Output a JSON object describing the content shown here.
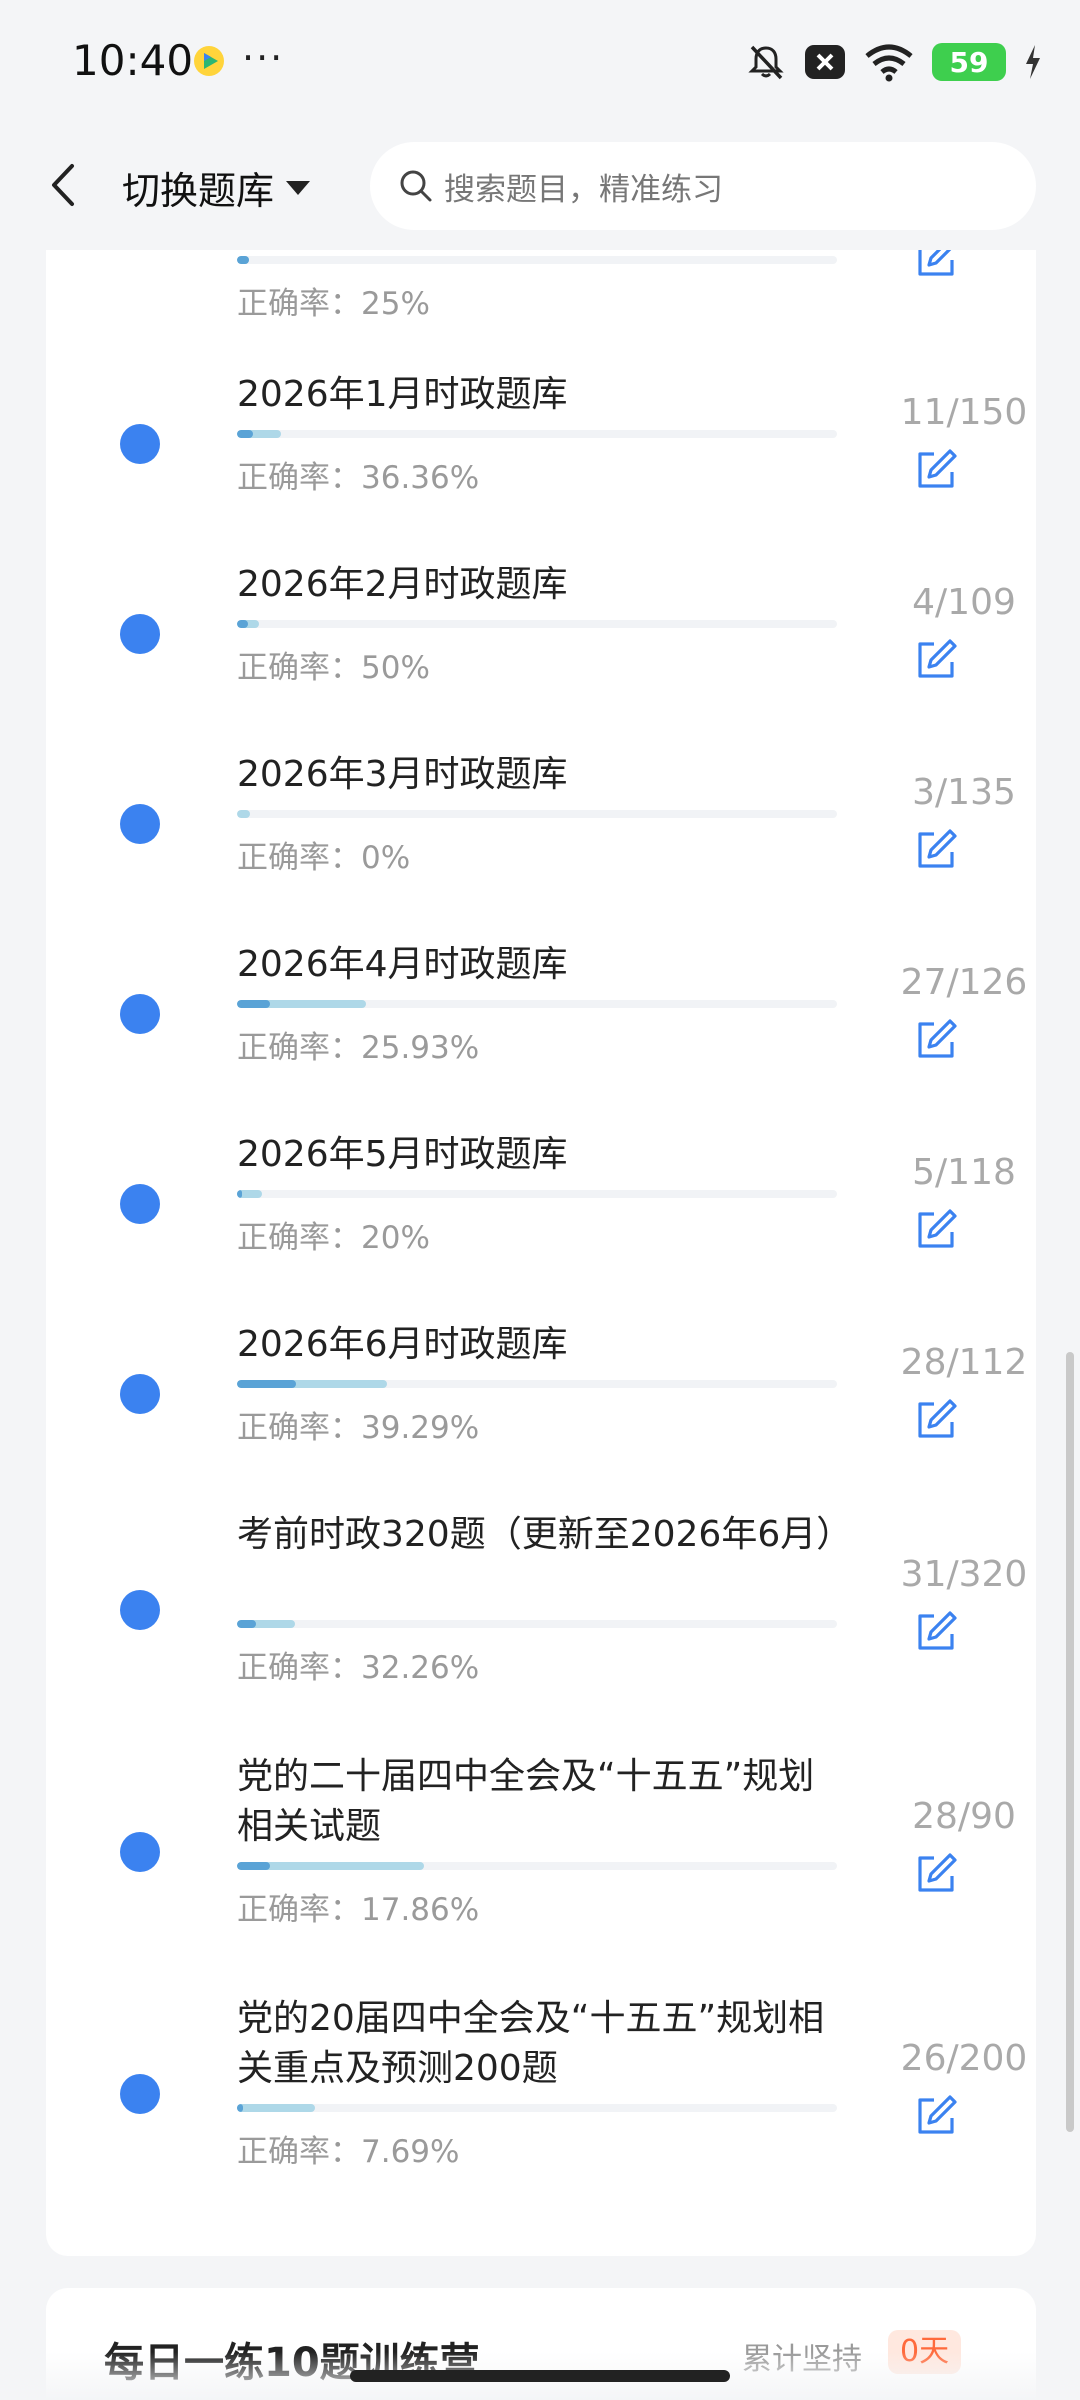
{
  "status": {
    "time": "10:40",
    "battery": "59"
  },
  "nav": {
    "switch_label": "切换题库",
    "search_placeholder": "搜索题目，精准练习"
  },
  "partial_item": {
    "accuracy": "正确率：25%",
    "progress": {
      "done": 0.02,
      "correct": 0.02
    }
  },
  "items": [
    {
      "title": "2026年1月时政题库",
      "count": "11/150",
      "accuracy": "正确率：36.36%",
      "progress": {
        "done": 0.0733,
        "correct": 0.0267
      }
    },
    {
      "title": "2026年2月时政题库",
      "count": "4/109",
      "accuracy": "正确率：50%",
      "progress": {
        "done": 0.0367,
        "correct": 0.0183
      }
    },
    {
      "title": "2026年3月时政题库",
      "count": "3/135",
      "accuracy": "正确率：0%",
      "progress": {
        "done": 0.0222,
        "correct": 0
      }
    },
    {
      "title": "2026年4月时政题库",
      "count": "27/126",
      "accuracy": "正确率：25.93%",
      "progress": {
        "done": 0.2143,
        "correct": 0.0556
      }
    },
    {
      "title": "2026年5月时政题库",
      "count": "5/118",
      "accuracy": "正确率：20%",
      "progress": {
        "done": 0.0424,
        "correct": 0.0085
      }
    },
    {
      "title": "2026年6月时政题库",
      "count": "28/112",
      "accuracy": "正确率：39.29%",
      "progress": {
        "done": 0.25,
        "correct": 0.0982
      }
    },
    {
      "title": "考前时政320题（更新至2026年6月）",
      "count": "31/320",
      "accuracy": "正确率：32.26%",
      "progress": {
        "done": 0.0969,
        "correct": 0.0313
      }
    },
    {
      "title": "党的二十届四中全会及“十五五”规划相关试题",
      "count": "28/90",
      "accuracy": "正确率：17.86%",
      "progress": {
        "done": 0.3111,
        "correct": 0.0556
      }
    },
    {
      "title": "党的20届四中全会及“十五五”规划相关重点及预测200题",
      "count": "26/200",
      "accuracy": "正确率：7.69%",
      "progress": {
        "done": 0.13,
        "correct": 0.01
      }
    }
  ],
  "next_card": {
    "title": "每日一练10题训练营",
    "meta": "累计坚持",
    "badge": "0天"
  },
  "colors": {
    "accent": "#3b82f0",
    "progress_done": "#aed8e8",
    "progress_correct": "#5aa3d6"
  }
}
